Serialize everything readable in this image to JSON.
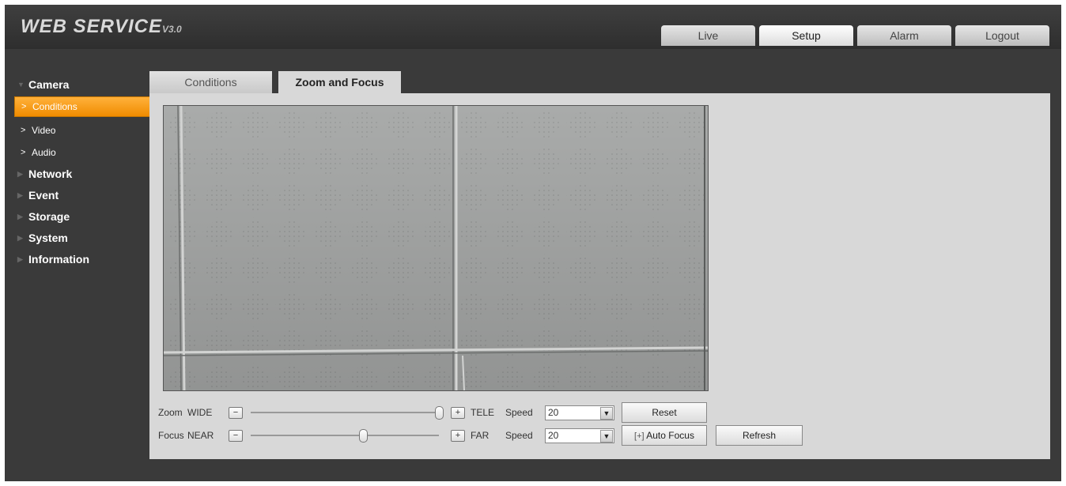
{
  "header": {
    "logo_text": "WEB SERVICE",
    "logo_version": "V3.0",
    "nav": [
      {
        "label": "Live"
      },
      {
        "label": "Setup"
      },
      {
        "label": "Alarm"
      },
      {
        "label": "Logout"
      }
    ],
    "active_nav": "Setup"
  },
  "sidebar": {
    "groups": [
      {
        "label": "Camera",
        "expanded": true,
        "items": [
          {
            "label": "Conditions",
            "active": true
          },
          {
            "label": "Video"
          },
          {
            "label": "Audio"
          }
        ]
      },
      {
        "label": "Network"
      },
      {
        "label": "Event"
      },
      {
        "label": "Storage"
      },
      {
        "label": "System"
      },
      {
        "label": "Information"
      }
    ]
  },
  "tabs": [
    {
      "label": "Conditions"
    },
    {
      "label": "Zoom and Focus",
      "active": true
    }
  ],
  "zoom": {
    "label": "Zoom",
    "min_label": "WIDE",
    "max_label": "TELE",
    "level": 1.0,
    "speed_label": "Speed",
    "speed_value": "20"
  },
  "focus": {
    "label": "Focus",
    "min_label": "NEAR",
    "max_label": "FAR",
    "level": 0.6,
    "speed_label": "Speed",
    "speed_value": "20"
  },
  "buttons": {
    "reset": "Reset",
    "auto_focus": "Auto Focus",
    "refresh": "Refresh"
  },
  "colors": {
    "accent": "#f49a12",
    "background": "#3a3a3a",
    "panel": "#d8d8d8"
  }
}
